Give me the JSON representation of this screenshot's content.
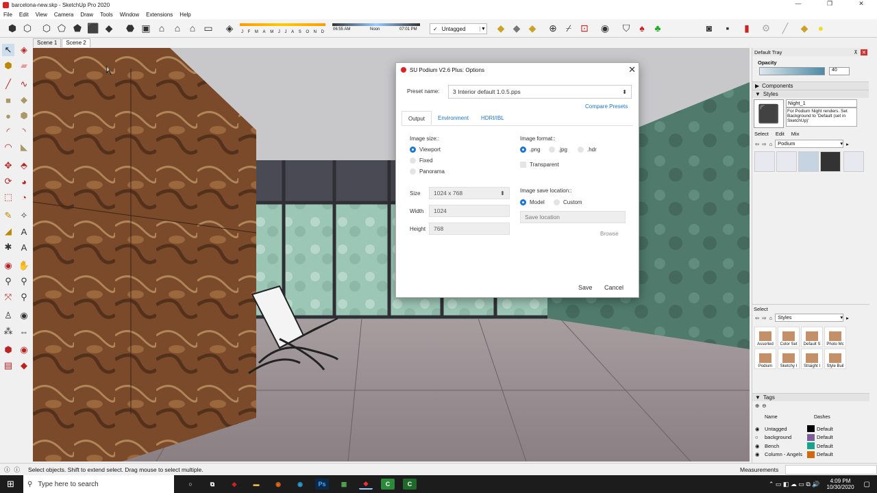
{
  "window": {
    "title": "barcelona-new.skp - SketchUp Pro 2020",
    "min": "—",
    "max": "❐",
    "close": "✕"
  },
  "menu": [
    "File",
    "Edit",
    "View",
    "Camera",
    "Draw",
    "Tools",
    "Window",
    "Extensions",
    "Help"
  ],
  "timeline": {
    "months": [
      "J",
      "F",
      "M",
      "A",
      "M",
      "J",
      "J",
      "A",
      "S",
      "O",
      "N",
      "D"
    ],
    "time_start": "06:55 AM",
    "time_mid": "Noon",
    "time_end": "07:01 PM"
  },
  "tag_selector": {
    "check": "✓",
    "value": "Untagged"
  },
  "scenes": [
    "Scene 1",
    "Scene 2"
  ],
  "dialog": {
    "title": "SU Podium V2.6 Plus: Options",
    "preset_label": "Preset name:",
    "preset_value": "3  Interior  default  1.0.5.pps",
    "compare": "Compare Presets",
    "tabs": [
      "Output",
      "Environment",
      "HDRI/IBL"
    ],
    "image_size_label": "Image size::",
    "size_options": [
      "Viewport",
      "Fixed",
      "Panorama"
    ],
    "size_label": "Size",
    "size_value": "1024 x 768",
    "width_label": "Width",
    "width_value": "1024",
    "height_label": "Height",
    "height_value": "768",
    "format_label": "Image format::",
    "formats": [
      ".png",
      ".jpg",
      ".hdr"
    ],
    "transparent": "Transparent",
    "save_loc_label": "Image save location::",
    "save_loc_options": [
      "Model",
      "Custom"
    ],
    "save_loc_placeholder": "Save location",
    "browse": "Browse",
    "save": "Save",
    "cancel": "Cancel"
  },
  "tray": {
    "title": "Default Tray",
    "opacity_label": "Opacity",
    "opacity_value": "40",
    "components": "Components",
    "styles": "Styles",
    "style_name": "Night_1",
    "style_desc": "For Podium Night renders. Set Background to 'Default (set in SketchUp)'",
    "tabs": [
      "Select",
      "Edit",
      "Mix"
    ],
    "collection": "Podium",
    "select2_label": "Select",
    "styles_collection": "Styles",
    "style_items": [
      "Assorted",
      "Color Set",
      "Default S",
      "Photo Mc",
      "Podium",
      "Sketchy I",
      "Straight I",
      "Style Buil"
    ],
    "tags_title": "Tags",
    "tags_col_name": "Name",
    "tags_col_dashes": "Dashes",
    "tags": [
      {
        "name": "Untagged",
        "color": "#000000",
        "dash": "Default"
      },
      {
        "name": "background",
        "color": "#7a5f9a",
        "dash": "Default"
      },
      {
        "name": "Bench",
        "color": "#1aa38c",
        "dash": "Default"
      },
      {
        "name": "Column - Angels",
        "color": "#d2690e",
        "dash": "Default"
      }
    ]
  },
  "status": {
    "hint": "Select objects. Shift to extend select. Drag mouse to select multiple.",
    "measurements": "Measurements"
  },
  "taskbar": {
    "search": "Type here to search",
    "time": "4:09 PM",
    "date": "10/30/2020"
  }
}
